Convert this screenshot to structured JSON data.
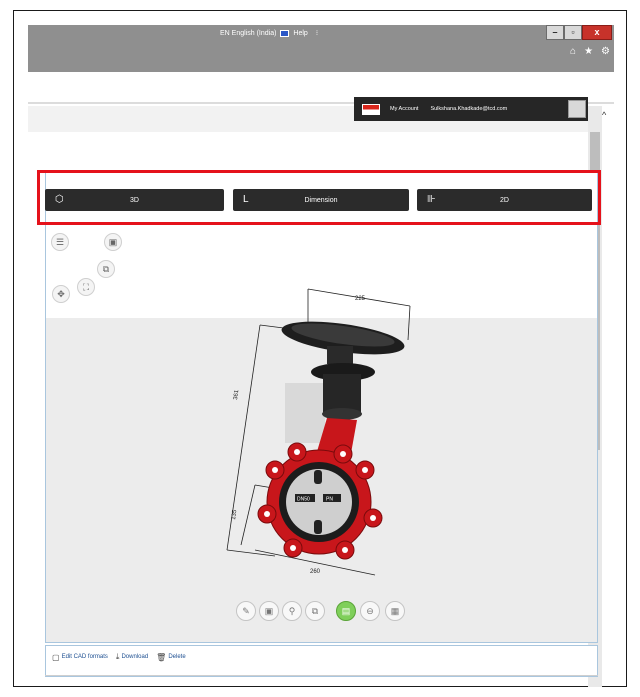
{
  "titlebar": {
    "language": "EN English (India)",
    "help": "Help",
    "caret": "⁝",
    "minimize": "–",
    "maximize": "▫",
    "close": "x",
    "nav_icons": [
      "⌂",
      "★",
      "⚙"
    ]
  },
  "userbar": {
    "my_account": "My Account",
    "email": "Sulkshana.Khadkade@tcd.com"
  },
  "scroll": {
    "up": "^"
  },
  "view_modes": [
    {
      "label": "3D",
      "icon": "⬡"
    },
    {
      "label": "Dimension",
      "icon": "L"
    },
    {
      "label": "2D",
      "icon": "⊪"
    }
  ],
  "tools": [
    "☰",
    "▣",
    "⧉",
    "⛶",
    "✥"
  ],
  "dimensions": {
    "top": "225",
    "left": "361",
    "lower_left": "135",
    "bottom": "260"
  },
  "body_labels": {
    "left": "DN50",
    "right": "PN"
  },
  "view_buttons": [
    "✎",
    "▣",
    "⚲",
    "⧉",
    "▤",
    "⊖",
    "▦"
  ],
  "actions": [
    {
      "icon": "▢",
      "label": "Edit CAD formats"
    },
    {
      "icon": "⤓",
      "label": "Download"
    },
    {
      "icon": "🗑",
      "label": "Delete"
    }
  ],
  "colors": {
    "highlight": "#e5121b",
    "button_bg": "#2b2b2b",
    "valve_red": "#c8161b",
    "active_view": "#7fcf5a"
  }
}
